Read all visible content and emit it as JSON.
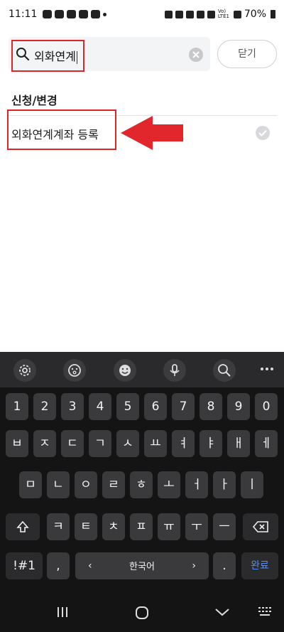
{
  "status_bar": {
    "time": "11:11",
    "network": "Vo) LTE1",
    "battery": "70%"
  },
  "search": {
    "value": "외화연계",
    "close_label": "닫기"
  },
  "section": {
    "title": "신청/변경"
  },
  "results": [
    {
      "label": "외화연계계좌 등록"
    }
  ],
  "annotation": {
    "color": "#d9262c"
  },
  "keyboard": {
    "number_row": [
      "1",
      "2",
      "3",
      "4",
      "5",
      "6",
      "7",
      "8",
      "9",
      "0"
    ],
    "row1": [
      "ㅂ",
      "ㅈ",
      "ㄷ",
      "ㄱ",
      "ㅅ",
      "ㅛ",
      "ㅕ",
      "ㅑ",
      "ㅐ",
      "ㅔ"
    ],
    "row2": [
      "ㅁ",
      "ㄴ",
      "ㅇ",
      "ㄹ",
      "ㅎ",
      "ㅗ",
      "ㅓ",
      "ㅏ",
      "ㅣ"
    ],
    "row3": [
      "ㅋ",
      "ㅌ",
      "ㅊ",
      "ㅍ",
      "ㅠ",
      "ㅜ",
      "ㅡ"
    ],
    "symbol_key": "!#1",
    "comma_key": ",",
    "language_label": "한국어",
    "period_key": ".",
    "done_key": "완료",
    "toolbar_icons": [
      "settings-icon",
      "emoji-face-icon",
      "sticker-icon",
      "microphone-icon",
      "search-icon",
      "more-icon"
    ]
  },
  "nav_bar": {
    "icons": [
      "recents-icon",
      "home-icon",
      "back-icon",
      "keyboard-icon"
    ]
  }
}
